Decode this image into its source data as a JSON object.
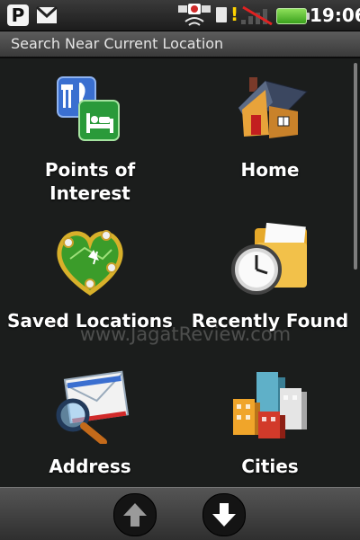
{
  "status_bar": {
    "p_icon_glyph": "P",
    "clock": "19:06",
    "icons": [
      "p-icon",
      "gmail-icon",
      "gps-icon",
      "sim-icon",
      "warning-icon",
      "signal-icon",
      "battery-icon"
    ]
  },
  "header": {
    "title": "Search Near Current Location"
  },
  "tiles": [
    {
      "line1": "Points of",
      "line2": "Interest",
      "icon": "points-of-interest-icon"
    },
    {
      "label": "Home",
      "icon": "home-icon"
    },
    {
      "label": "Saved Locations",
      "icon": "saved-locations-icon"
    },
    {
      "label": "Recently Found",
      "icon": "recently-found-icon"
    },
    {
      "label": "Address",
      "icon": "address-icon"
    },
    {
      "label": "Cities",
      "icon": "cities-icon"
    }
  ],
  "watermark": "www.JagatReview.com",
  "bottom_bar": {
    "buttons": [
      "previous-page-button",
      "next-page-button"
    ]
  },
  "colors": {
    "background": "#1b1d1c",
    "battery": "#4cbb2a",
    "warning": "#ffd400"
  }
}
